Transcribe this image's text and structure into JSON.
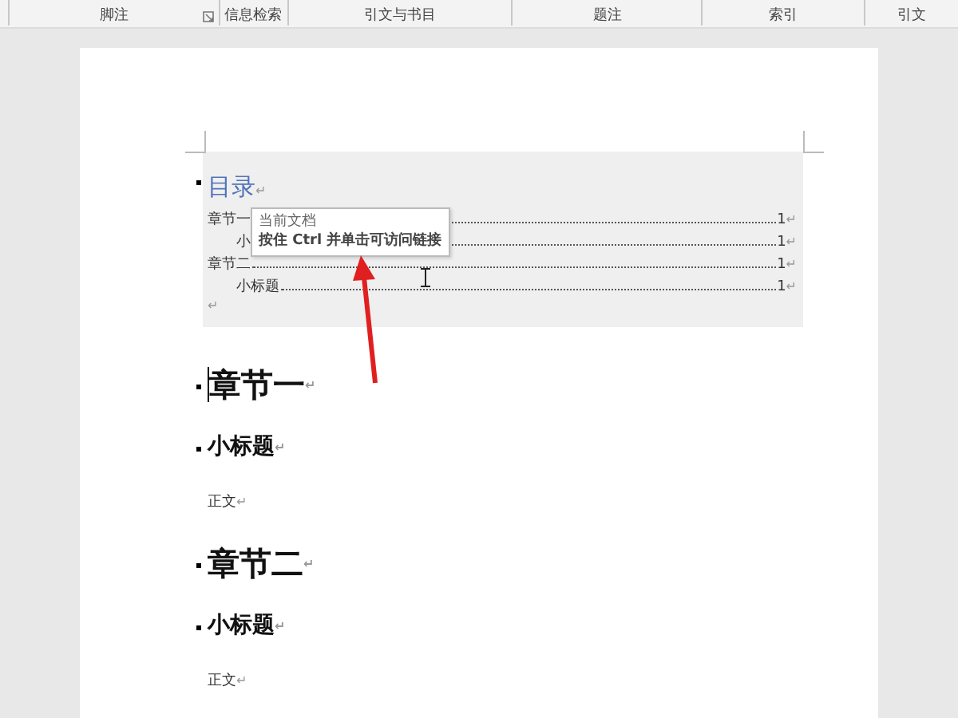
{
  "ribbon": {
    "groups": [
      {
        "label": "脚注",
        "launcher": true
      },
      {
        "label": "信息检索",
        "launcher": false
      },
      {
        "label": "引文与书目",
        "launcher": false
      },
      {
        "label": "题注",
        "launcher": false
      },
      {
        "label": "索引",
        "launcher": false
      },
      {
        "label": "引文",
        "launcher": false
      }
    ]
  },
  "toc": {
    "title": "目录",
    "mark": "↵",
    "entries": [
      {
        "kind": "level1",
        "text": "章节一",
        "page": "1",
        "mark": "↵"
      },
      {
        "kind": "level2",
        "text": "小",
        "page": "1",
        "mark": "↵"
      },
      {
        "kind": "level1",
        "text": "章节二",
        "page": "1",
        "mark": "↵"
      },
      {
        "kind": "level2",
        "text": "小标题",
        "page": "1",
        "mark": "↵"
      }
    ],
    "trailing_mark": "↵"
  },
  "tooltip": {
    "line_1": "当前文档",
    "line_2": "按住 Ctrl 并单击可访问链接"
  },
  "body": [
    {
      "kind": "heading1",
      "text": "章节一",
      "mark": "↵",
      "cursor": true
    },
    {
      "kind": "heading2",
      "text": "小标题",
      "mark": "↵",
      "cursor": false
    },
    {
      "kind": "body",
      "text": "正文",
      "mark": "↵",
      "cursor": false
    },
    {
      "kind": "heading1",
      "text": "章节二",
      "mark": "↵",
      "cursor": false
    },
    {
      "kind": "heading2",
      "text": "小标题",
      "mark": "↵",
      "cursor": false
    },
    {
      "kind": "body",
      "text": "正文",
      "mark": "↵",
      "cursor": false
    }
  ]
}
